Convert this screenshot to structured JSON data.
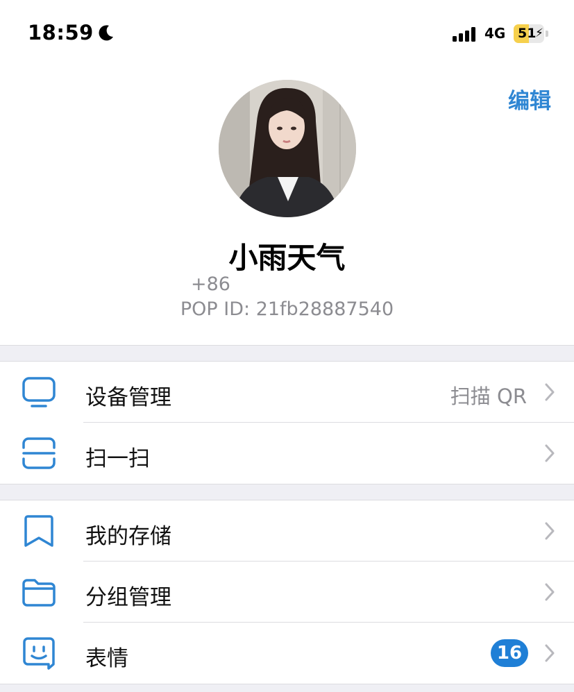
{
  "status_bar": {
    "time": "18:59",
    "network": "4G",
    "battery_level": "51",
    "battery_fraction": 0.51,
    "moon_icon": "moon-icon",
    "signal_icon": "cellular-signal-icon",
    "battery_icon": "battery-charging-icon"
  },
  "header": {
    "edit_label": "编辑",
    "accent_color": "#2f86d3"
  },
  "profile": {
    "name": "小雨天气",
    "phone_prefix": "+86",
    "pop_id": "POP ID: 21fb28887540"
  },
  "sections": [
    {
      "rows": [
        {
          "label": "设备管理",
          "icon": "monitor-icon",
          "value": "扫描 QR"
        },
        {
          "label": "扫一扫",
          "icon": "scan-icon"
        }
      ]
    },
    {
      "rows": [
        {
          "label": "我的存储",
          "icon": "bookmark-icon"
        },
        {
          "label": "分组管理",
          "icon": "folder-icon"
        },
        {
          "label": "表情",
          "icon": "smiley-sticker-icon",
          "badge": "16"
        }
      ]
    }
  ],
  "colors": {
    "icon_blue": "#2f86d3",
    "badge_blue": "#1f7fd6",
    "secondary_text": "#8c8c91",
    "separator_bg": "#efeff4"
  }
}
